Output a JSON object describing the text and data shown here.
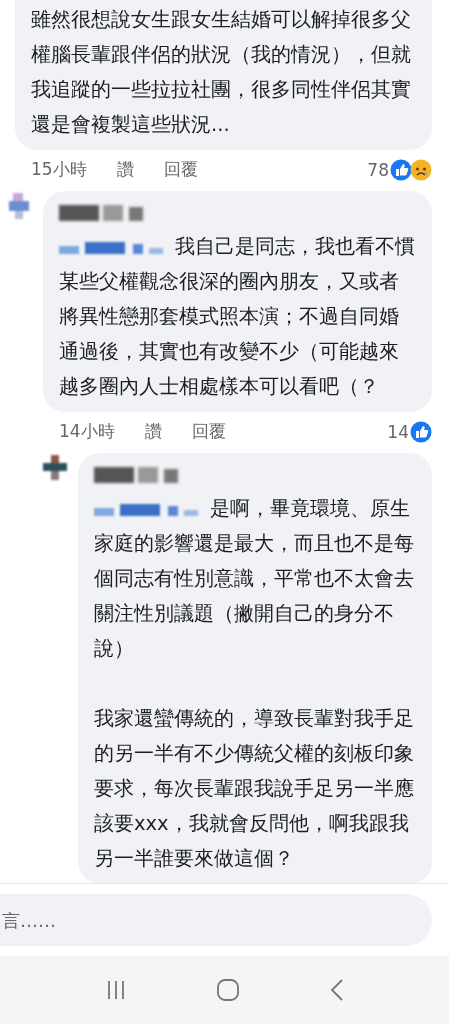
{
  "comments": [
    {
      "paragraphs": [
        "雖然很想說女生跟女生結婚可以解掉很多父權腦長輩跟伴侶的狀況（我的情況），但就我追蹤的一些拉拉社團，很多同性伴侶其實還是會複製這些狀況..."
      ],
      "footer": {
        "time": "15小時",
        "like": "讚",
        "reply": "回覆",
        "count": "78",
        "reactions": [
          {
            "kind": "like"
          },
          {
            "kind": "sad"
          }
        ]
      },
      "children": [
        {
          "paragraphs": [
            "我自己是同志，我也看不慣某些父權觀念很深的圈內朋友，又或者將異性戀那套模式照本演；不過自同婚通過後，其實也有改變不少（可能越來越多圈內人士相處樣本可以看吧（？"
          ],
          "footer": {
            "time": "14小時",
            "like": "讚",
            "reply": "回覆",
            "count": "14",
            "reactions": [
              {
                "kind": "like"
              }
            ]
          },
          "children": [
            {
              "paragraphs": [
                "是啊，畢竟環境、原生家庭的影響還是最大，而且也不是每個同志有性別意識，平常也不太會去關注性別議題（撇開自己的身分不說）",
                "我家還蠻傳統的，導致長輩對我手足的另一半有不少傳統父權的刻板印象要求，每次長輩跟我說手足另一半應該要xxx，我就會反問他，啊我跟我另一半誰要來做這個？"
              ]
            }
          ]
        }
      ]
    }
  ],
  "input": {
    "placeholder": "言……"
  }
}
